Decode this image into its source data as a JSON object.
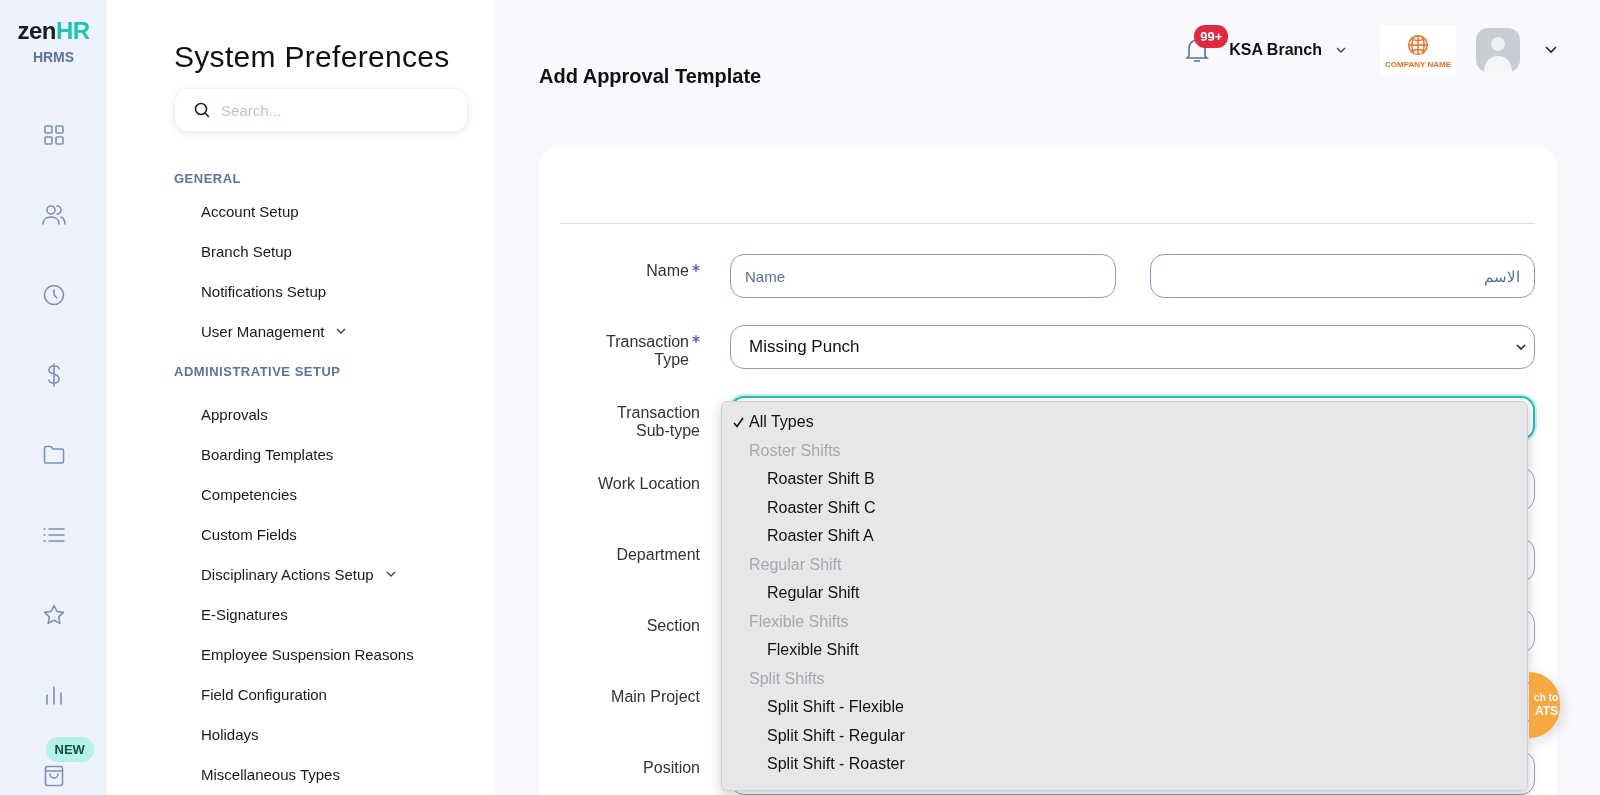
{
  "brand": {
    "logo_main": "zen",
    "logo_accent": "HR",
    "product": "HRMS"
  },
  "rail": {
    "new_badge": "NEW"
  },
  "settings_nav": {
    "title": "System Preferences",
    "search": {
      "placeholder": "Search..."
    },
    "sections": [
      {
        "heading": "GENERAL",
        "items": [
          {
            "label": "Account Setup",
            "expandable": false
          },
          {
            "label": "Branch Setup",
            "expandable": false
          },
          {
            "label": "Notifications Setup",
            "expandable": false
          },
          {
            "label": "User Management",
            "expandable": true
          }
        ]
      },
      {
        "heading": "ADMINISTRATIVE SETUP",
        "items": [
          {
            "label": "Approvals",
            "expandable": false
          },
          {
            "label": "Boarding Templates",
            "expandable": false
          },
          {
            "label": "Competencies",
            "expandable": false
          },
          {
            "label": "Custom Fields",
            "expandable": false
          },
          {
            "label": "Disciplinary Actions Setup",
            "expandable": true
          },
          {
            "label": "E-Signatures",
            "expandable": false
          },
          {
            "label": "Employee Suspension Reasons",
            "expandable": false
          },
          {
            "label": "Field Configuration",
            "expandable": false
          },
          {
            "label": "Holidays",
            "expandable": false
          },
          {
            "label": "Miscellaneous Types",
            "expandable": false
          }
        ]
      }
    ]
  },
  "header": {
    "notifications_badge": "99+",
    "branch": "KSA Branch",
    "company_logo_text": "COMPANY NAME"
  },
  "page_title": "Add Approval Template",
  "form": {
    "rows": [
      {
        "label": "Name",
        "required": true,
        "kind": "text-pair",
        "inputs": [
          {
            "placeholder": "Name"
          },
          {
            "placeholder": "الاسم"
          }
        ]
      },
      {
        "label": "Transaction Type",
        "required": true,
        "kind": "select",
        "value": "Missing Punch"
      },
      {
        "label": "Transaction Sub-type",
        "required": false,
        "kind": "select-open"
      },
      {
        "label": "Work Location",
        "required": false,
        "kind": "select"
      },
      {
        "label": "Department",
        "required": false,
        "kind": "select"
      },
      {
        "label": "Section",
        "required": false,
        "kind": "select"
      },
      {
        "label": "Main Project",
        "required": false,
        "kind": "select"
      },
      {
        "label": "Position",
        "required": false,
        "kind": "select"
      }
    ]
  },
  "dropdown": {
    "options": [
      {
        "kind": "option",
        "label": "All Types",
        "selected": true
      },
      {
        "kind": "group",
        "label": "Roster Shifts",
        "children": [
          {
            "label": "Roaster Shift B",
            "selected": false
          },
          {
            "label": "Roaster Shift C",
            "selected": false
          },
          {
            "label": "Roaster Shift A",
            "selected": false
          }
        ]
      },
      {
        "kind": "group",
        "label": "Regular Shift",
        "children": [
          {
            "label": "Regular Shift",
            "selected": false
          }
        ]
      },
      {
        "kind": "group",
        "label": "Flexible Shifts",
        "children": [
          {
            "label": "Flexible Shift",
            "selected": false
          }
        ]
      },
      {
        "kind": "group",
        "label": "Split Shifts",
        "children": [
          {
            "label": "Split Shift - Flexible",
            "selected": false
          },
          {
            "label": "Split Shift - Regular",
            "selected": false
          },
          {
            "label": "Split Shift - Roaster",
            "selected": false
          }
        ]
      }
    ]
  },
  "ats_button": {
    "line_1": "ch to",
    "line_2": "ATS"
  }
}
